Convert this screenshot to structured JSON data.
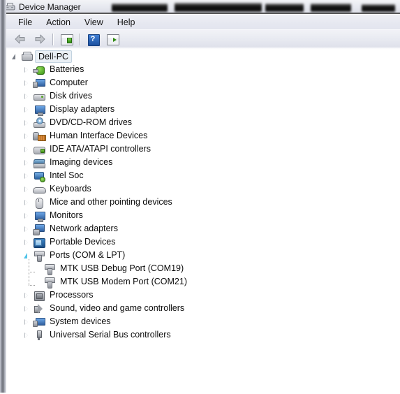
{
  "window": {
    "title": "Device Manager",
    "title_icon": "device-manager-icon",
    "redacted_blocks": 5
  },
  "menu": {
    "items": [
      {
        "label": "File",
        "name": "menu-file"
      },
      {
        "label": "Action",
        "name": "menu-action"
      },
      {
        "label": "View",
        "name": "menu-view"
      },
      {
        "label": "Help",
        "name": "menu-help"
      }
    ]
  },
  "toolbar": {
    "buttons": [
      {
        "name": "back-button",
        "icon": "back-arrow-icon"
      },
      {
        "name": "forward-button",
        "icon": "forward-arrow-icon"
      },
      {
        "name": "properties-button",
        "icon": "properties-icon"
      },
      {
        "name": "help-button",
        "icon": "help-question-icon",
        "glyph": "?"
      },
      {
        "name": "scan-hardware-changes-button",
        "icon": "scan-hardware-icon"
      }
    ]
  },
  "tree": {
    "root": {
      "label": "Dell-PC",
      "icon": "computer-tower-icon",
      "selected": true,
      "expanded": true
    },
    "nodes": [
      {
        "label": "Batteries",
        "icon": "battery-icon",
        "expanded": false,
        "level": 1
      },
      {
        "label": "Computer",
        "icon": "computer-monitor-plug-icon",
        "expanded": false,
        "level": 1
      },
      {
        "label": "Disk drives",
        "icon": "disk-drive-icon",
        "expanded": false,
        "level": 1
      },
      {
        "label": "Display adapters",
        "icon": "display-adapter-icon",
        "expanded": false,
        "level": 1
      },
      {
        "label": "DVD/CD-ROM drives",
        "icon": "dvd-drive-icon",
        "expanded": false,
        "level": 1
      },
      {
        "label": "Human Interface Devices",
        "icon": "human-interface-device-icon",
        "expanded": false,
        "level": 1
      },
      {
        "label": "IDE ATA/ATAPI controllers",
        "icon": "ide-controller-icon",
        "expanded": false,
        "level": 1
      },
      {
        "label": "Imaging devices",
        "icon": "imaging-device-icon",
        "expanded": false,
        "level": 1
      },
      {
        "label": "Intel Soc",
        "icon": "intel-soc-icon",
        "expanded": false,
        "level": 1
      },
      {
        "label": "Keyboards",
        "icon": "keyboard-icon",
        "expanded": false,
        "level": 1
      },
      {
        "label": "Mice and other pointing devices",
        "icon": "mouse-icon",
        "expanded": false,
        "level": 1
      },
      {
        "label": "Monitors",
        "icon": "monitor-icon",
        "expanded": false,
        "level": 1
      },
      {
        "label": "Network adapters",
        "icon": "network-adapter-icon",
        "expanded": false,
        "level": 1
      },
      {
        "label": "Portable Devices",
        "icon": "portable-device-icon",
        "expanded": false,
        "level": 1
      },
      {
        "label": "Ports (COM & LPT)",
        "icon": "port-connector-icon",
        "expanded": true,
        "level": 1
      },
      {
        "label": "MTK USB Debug Port (COM19)",
        "icon": "port-connector-icon",
        "expanded": false,
        "level": 2
      },
      {
        "label": "MTK USB Modem Port (COM21)",
        "icon": "port-connector-icon",
        "expanded": false,
        "level": 2
      },
      {
        "label": "Processors",
        "icon": "processor-icon",
        "expanded": false,
        "level": 1
      },
      {
        "label": "Sound, video and game controllers",
        "icon": "sound-controller-icon",
        "expanded": false,
        "level": 1
      },
      {
        "label": "System devices",
        "icon": "system-device-icon",
        "expanded": false,
        "level": 1
      },
      {
        "label": "Universal Serial Bus controllers",
        "icon": "usb-controller-icon",
        "expanded": false,
        "level": 1
      }
    ]
  },
  "colors": {
    "titlebar_bg": "#e6e8ef",
    "menubar_bg": "#e7e9f1",
    "toolbar_bg": "#e9ebf2",
    "panel_bg": "#ffffff",
    "text": "#0a0a0a",
    "selection_bg": "#e9eff5",
    "selection_border": "#c3d3e0",
    "expanded_twisty": "#4fc3e8",
    "collapsed_twisty": "#9aa0a8",
    "frame_edge": "#6e7179"
  }
}
